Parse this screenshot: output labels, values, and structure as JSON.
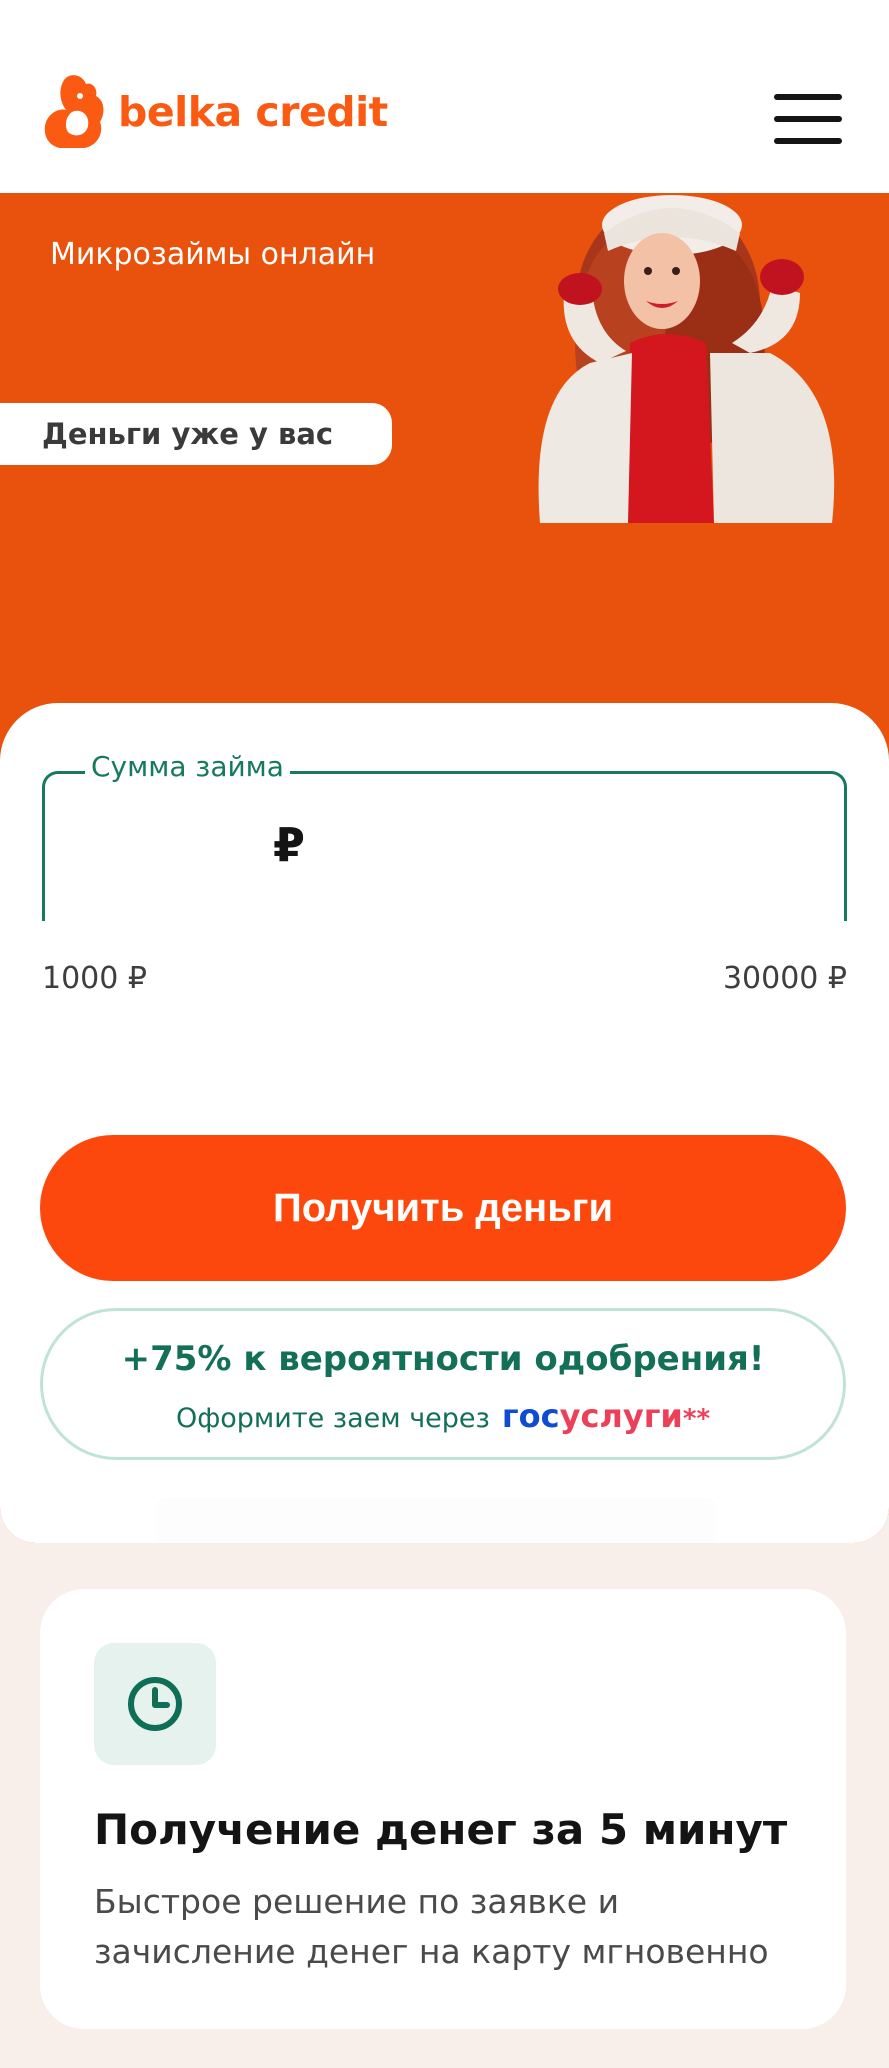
{
  "header": {
    "logo_text": "belka credit",
    "brand_color": "#fb5a12",
    "menu_icon": "hamburger-menu-icon"
  },
  "hero": {
    "title": "Микрозаймы онлайн",
    "pill_text": "Деньги уже у вас",
    "background": "#e9520c"
  },
  "loan_form": {
    "amount_label": "Сумма займа",
    "amount_value": "",
    "currency_symbol": "₽",
    "range_min": "1000 ₽",
    "range_max": "30000 ₽",
    "submit_label": "Получить деньги",
    "promo": {
      "title": "+75% к вероятности одобрения!",
      "subtitle": "Оформите заем через",
      "gos_part1": "гос",
      "gos_part2": "услуги",
      "stars": "**"
    }
  },
  "feature": {
    "icon": "clock-icon",
    "title": "Получение денег за 5 минут",
    "text": "Быстрое решение по заявке и зачисление денег на карту мгновенно"
  }
}
